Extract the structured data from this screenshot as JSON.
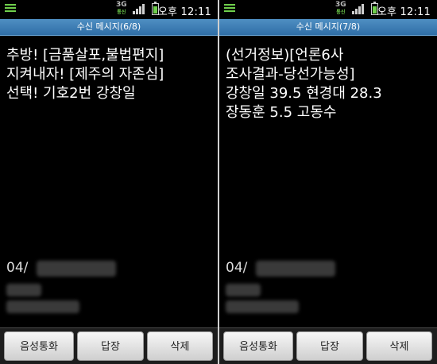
{
  "status": {
    "network": "3G",
    "network_sub": "통신",
    "time": "오후 12:11"
  },
  "screens": [
    {
      "title": "수신 메시지(6/8)",
      "lines": [
        "추방! [금품살포,불법편지]",
        "지켜내자! [제주의 자존심]",
        "선택! 기호2번 강창일"
      ],
      "date_prefix": "04/"
    },
    {
      "title": "수신 메시지(7/8)",
      "lines": [
        "(선거정보)[언론6사",
        "조사결과-당선가능성]",
        "강창일 39.5 현경대 28.3",
        "장동훈 5.5 고동수"
      ],
      "date_prefix": "04/"
    }
  ],
  "buttons": {
    "call": "음성통화",
    "reply": "답장",
    "delete": "삭제"
  },
  "colors": {
    "title_bar": "#2f6ea6",
    "status_green": "#6fcf4c",
    "background": "#000000"
  }
}
